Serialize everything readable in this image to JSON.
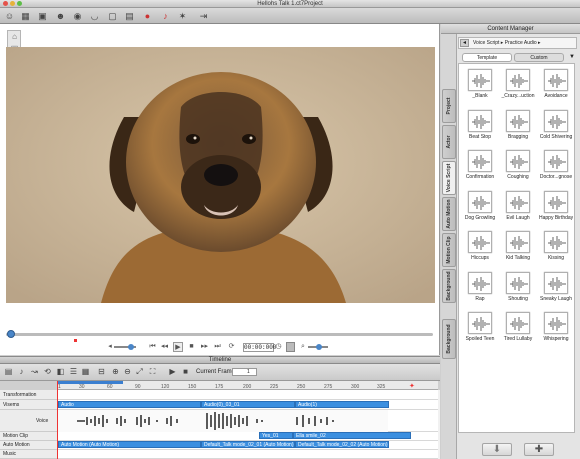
{
  "window": {
    "title": "Hellohs Talk 1.ct7Project"
  },
  "toolbar": {
    "icons": [
      "actor-icon",
      "scene-icon",
      "image-icon",
      "face-icon",
      "eye-icon",
      "mouth-icon",
      "portrait-icon",
      "picture-icon",
      "record-icon",
      "audio-icon",
      "motion-icon",
      "export-icon"
    ]
  },
  "stage": {
    "timecode": "00:00:000"
  },
  "timeline": {
    "title": "Timeline",
    "current_frame_label": "Current Frame:",
    "current_frame_value": "1",
    "ruler_ticks": [
      "1",
      "30",
      "60",
      "90",
      "120",
      "150",
      "175",
      "200",
      "225",
      "250",
      "275",
      "300",
      "325"
    ],
    "tracks": [
      {
        "label": "Transformation"
      },
      {
        "label": "Visems"
      },
      {
        "label": "Voice"
      },
      {
        "label": "Motion Clip"
      },
      {
        "label": "Auto Motion"
      },
      {
        "label": "Music"
      }
    ],
    "clips": {
      "visems": [
        "Audio",
        "Audio(0)_03_01",
        "Audio(1)"
      ],
      "motion": [
        "Yes_01",
        "Ella smile_02"
      ],
      "auto_motion": [
        "Auto Motion (Auto Motion)",
        "Default_Talk mode_02_01 (Auto Motion)",
        "Default_Talk mode_02_02 (Auto Motion)"
      ]
    }
  },
  "content_manager": {
    "title": "Content Manager",
    "breadcrumb": "Voice Script ▸ Practice Audio ▸",
    "tabs": [
      "Template",
      "Custom"
    ],
    "side_tabs": [
      "Project",
      "Actor",
      "Voice Script",
      "Auto Motion",
      "Motion Clip",
      "Background",
      "Background"
    ],
    "items": [
      "_Blank",
      "_Crazy...uction",
      "Avoidance",
      "Beat Stop",
      "Bragging",
      "Cold Shivering",
      "Confirmation",
      "Coughing",
      "Doctor...gnose",
      "Dog Growling",
      "Evil Laugh",
      "Happy Birthday",
      "Hiccups",
      "Kid Talking",
      "Kissing",
      "Rap",
      "Shouting",
      "Sneaky Laugh",
      "Spoiled Teen",
      "Tired Lullaby",
      "Whispering"
    ]
  },
  "colors": {
    "clip": "#3b8fe0",
    "playhead": "#e33333",
    "accent": "#4a86c8"
  }
}
